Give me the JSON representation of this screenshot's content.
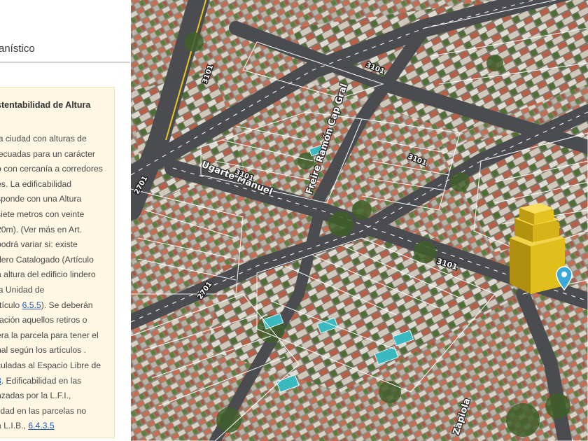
{
  "panel": {
    "title": "anístico",
    "card": {
      "title": "stentabilidad de Altura",
      "lines": [
        {
          "pre": " la ciudad con alturas de"
        },
        {
          "pre": "lecuadas para un carácter"
        },
        {
          "pre": "o con cercanía a corredores"
        },
        {
          "pre": "es. La edificabilidad"
        },
        {
          "pre": "sponde con una Altura"
        },
        {
          "pre": "siete metros con veinte"
        },
        {
          "pre": "20m). (Ver más en Art."
        },
        {
          "pre": "podrá variar si: existe"
        },
        {
          "pre": "dero Catalogado (Artículo"
        },
        {
          "pre": "a altura del edificio lindero"
        },
        {
          "pre": " la Unidad de"
        },
        {
          "pre": "rtículo ",
          "link": "6.5.5",
          "post": "). Se deberán"
        },
        {
          "pre": "ración aquellos retiros o"
        },
        {
          "pre": "era la parcela para tener el"
        },
        {
          "pre": "nal según los artículos ."
        },
        {
          "pre": "culadas al Espacio Libre de"
        },
        {
          "pre": "",
          "link": "3",
          "post": ". Edificabilidad en las"
        },
        {
          "pre": "nzadas por la L.F.I.,"
        },
        {
          "pre": "lidad en las parcelas no"
        },
        {
          "pre": "a L.I.B., ",
          "link": "6.4.3.5",
          "post": ""
        }
      ]
    }
  },
  "map": {
    "street_labels": [
      {
        "text": "Ugarte Manuel"
      },
      {
        "text": "Freire Ramón Cap Gral"
      },
      {
        "text": "Zapiola"
      }
    ],
    "number_labels": [
      {
        "text": "3101"
      },
      {
        "text": "2701"
      },
      {
        "text": "3101"
      },
      {
        "text": "3101"
      },
      {
        "text": "3101"
      },
      {
        "text": "2701"
      },
      {
        "text": "3101"
      }
    ],
    "building_color": "#e8c41a",
    "pin_color": "#3aa8d8"
  }
}
